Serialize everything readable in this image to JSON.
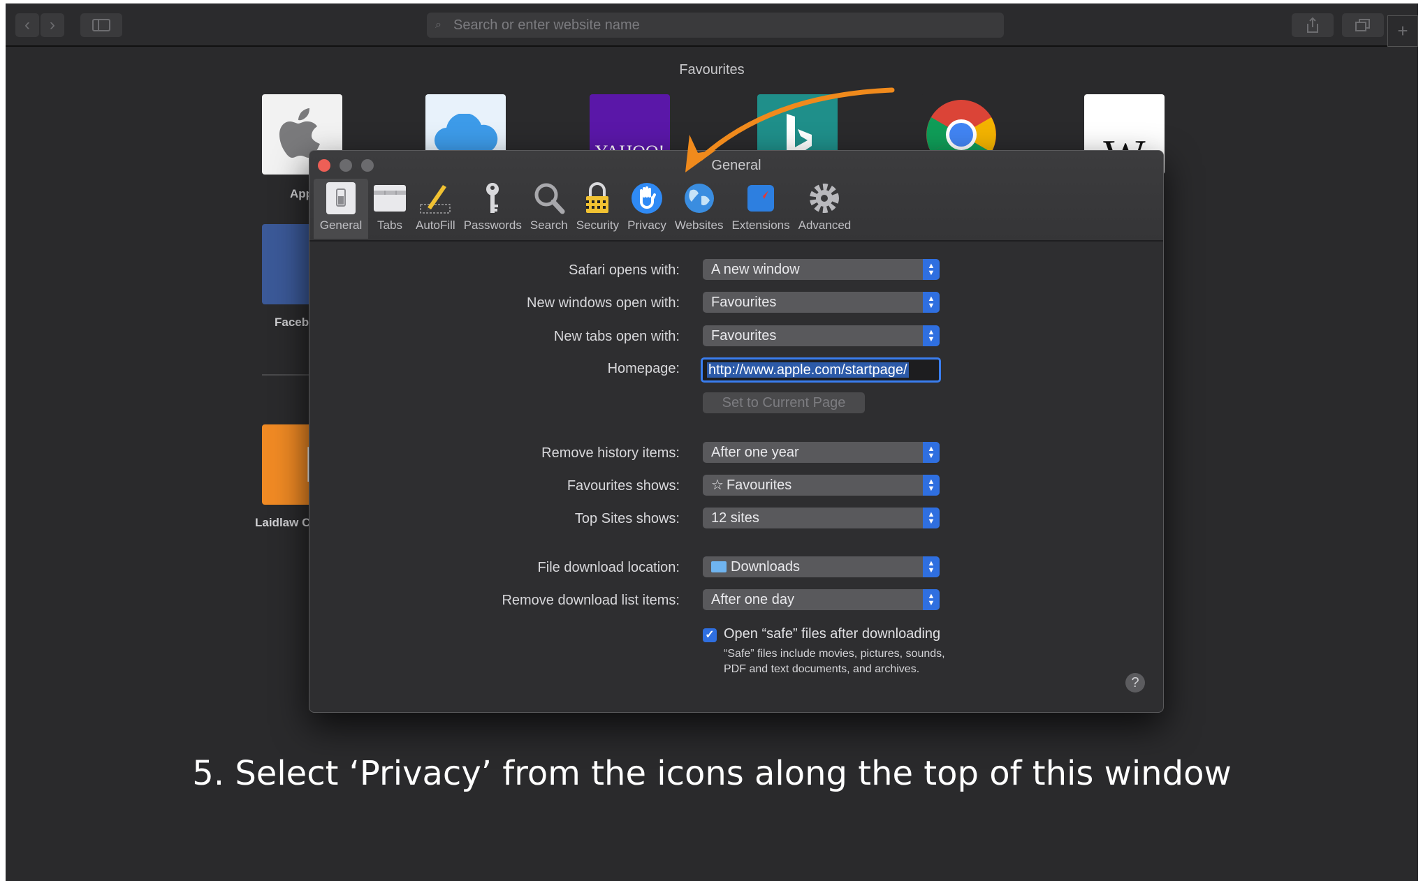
{
  "browser": {
    "address_placeholder": "Search or enter website name",
    "back_icon": "chevron-left-icon",
    "forward_icon": "chevron-right-icon",
    "sidebar_icon": "sidebar-icon",
    "share_icon": "share-icon",
    "tabs_icon": "tabs-overview-icon",
    "newtab_label": "+"
  },
  "favourites": {
    "title": "Favourites",
    "tiles": [
      {
        "label": "App",
        "icon": "apple-logo-icon",
        "color": "#f2f2f2"
      },
      {
        "label": "",
        "icon": "icloud-icon",
        "color": "#e8f2fb"
      },
      {
        "label": "YAHOO!",
        "icon": "yahoo-logo",
        "color": "#5a17a8"
      },
      {
        "label": "",
        "icon": "bing-logo-icon",
        "color": "#1f8f8a"
      },
      {
        "label": "",
        "icon": "chrome-logo-icon",
        "color": "#2a2a2c"
      },
      {
        "label": "W",
        "icon": "wikipedia-logo-icon",
        "color": "#ffffff"
      },
      {
        "label": "Faceb",
        "icon": "facebook-logo-icon",
        "color": "#3b5998"
      },
      {
        "label": "Laidlaw C",
        "icon": "laidlaw-logo",
        "color": "#f08a24",
        "letter": "L"
      }
    ]
  },
  "prefs": {
    "title": "General",
    "tabs": [
      {
        "label": "General",
        "icon": "general-switch-icon",
        "active": true
      },
      {
        "label": "Tabs",
        "icon": "tabs-icon"
      },
      {
        "label": "AutoFill",
        "icon": "autofill-pencil-icon"
      },
      {
        "label": "Passwords",
        "icon": "key-icon"
      },
      {
        "label": "Search",
        "icon": "magnifier-icon"
      },
      {
        "label": "Security",
        "icon": "padlock-icon"
      },
      {
        "label": "Privacy",
        "icon": "privacy-hand-icon"
      },
      {
        "label": "Websites",
        "icon": "globe-icon"
      },
      {
        "label": "Extensions",
        "icon": "extensions-compass-icon"
      },
      {
        "label": "Advanced",
        "icon": "gear-icon"
      }
    ],
    "settings": {
      "safari_opens_label": "Safari opens with:",
      "safari_opens_value": "A new window",
      "new_windows_label": "New windows open with:",
      "new_windows_value": "Favourites",
      "new_tabs_label": "New tabs open with:",
      "new_tabs_value": "Favourites",
      "homepage_label": "Homepage:",
      "homepage_value": "http://www.apple.com/startpage/",
      "set_current_label": "Set to Current Page",
      "remove_history_label": "Remove history items:",
      "remove_history_value": "After one year",
      "favourites_shows_label": "Favourites shows:",
      "favourites_shows_value": "Favourites",
      "top_sites_label": "Top Sites shows:",
      "top_sites_value": "12 sites",
      "download_location_label": "File download location:",
      "download_location_value": "Downloads",
      "remove_download_label": "Remove download list items:",
      "remove_download_value": "After one day",
      "open_safe_label": "Open “safe” files after downloading",
      "open_safe_checked": true,
      "open_safe_note": "“Safe” files include movies, pictures, sounds, PDF and text documents, and archives.",
      "help_label": "?"
    }
  },
  "caption": "5. Select ‘Privacy’ from the icons along the top of this window",
  "colors": {
    "accent": "#2f6fe0",
    "arrow": "#f08a1c",
    "close": "#ed5f56"
  }
}
